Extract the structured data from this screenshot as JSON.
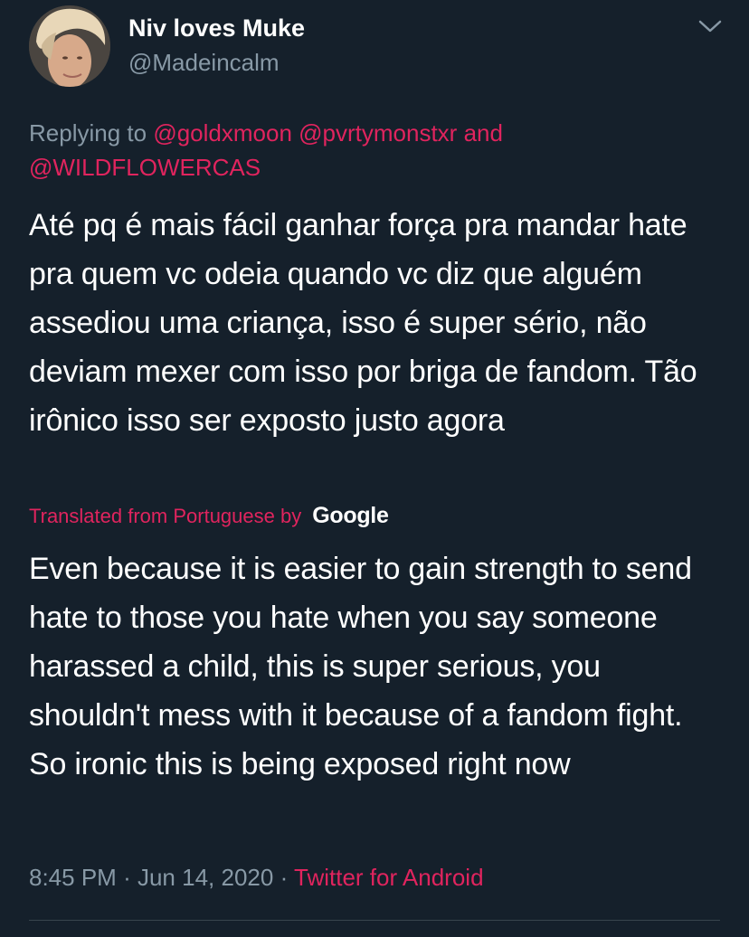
{
  "user": {
    "display_name": "Niv loves Muke",
    "handle": "@Madeincalm"
  },
  "reply": {
    "prefix": "Replying to",
    "mention_1": "@goldxmoon",
    "mention_2": "@pvrtymonstxr",
    "joiner": "and",
    "mention_3": "@WILDFLOWERCAS"
  },
  "tweet": {
    "text": "Até pq é mais fácil ganhar força pra mandar hate pra quem vc odeia quando vc diz que alguém assediou uma criança, isso é super sério, não deviam mexer com isso por briga de fandom. Tão irônico isso ser exposto justo agora"
  },
  "translation": {
    "label": "Translated from Portuguese by",
    "provider": "Google",
    "text": "Even because it is easier to gain strength to send hate to those you hate when you say someone harassed a child, this is super serious, you shouldn't mess with it because of a fandom fight. So ironic this is being exposed right now"
  },
  "meta": {
    "time": "8:45 PM",
    "separator": "·",
    "date": "Jun 14, 2020",
    "source": "Twitter for Android"
  },
  "colors": {
    "background": "#15202b",
    "accent": "#e0245e",
    "secondary_text": "#8899a6",
    "divider": "#38444d"
  },
  "icons": {
    "caret": "chevron-down-icon",
    "avatar": "avatar"
  }
}
